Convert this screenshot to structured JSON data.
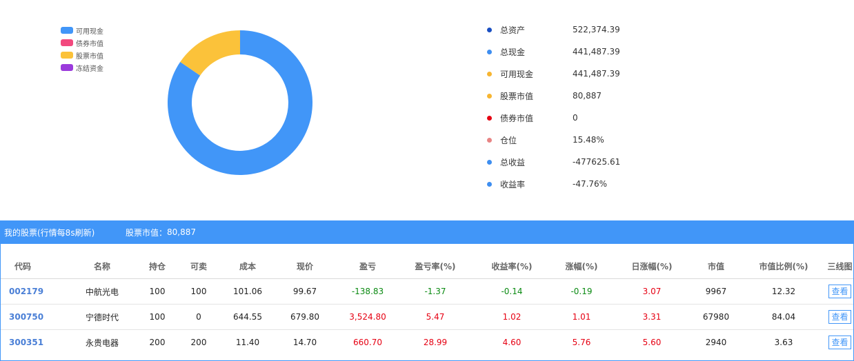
{
  "legend": [
    {
      "label": "可用现金",
      "color": "#4196f8"
    },
    {
      "label": "债券市值",
      "color": "#f2497e"
    },
    {
      "label": "股票市值",
      "color": "#fbc23a"
    },
    {
      "label": "冻结资金",
      "color": "#9b3bdc"
    }
  ],
  "chart_data": {
    "type": "pie",
    "categories": [
      "可用现金",
      "债券市值",
      "股票市值",
      "冻结资金"
    ],
    "values": [
      441487.39,
      0,
      80887,
      0
    ],
    "colors": [
      "#4196f8",
      "#f2497e",
      "#fbc23a",
      "#9b3bdc"
    ]
  },
  "summary": [
    {
      "label": "总资产",
      "value": "522,374.39",
      "color": "#1a4fc2"
    },
    {
      "label": "总现金",
      "value": "441,487.39",
      "color": "#3e8ef0"
    },
    {
      "label": "可用现金",
      "value": "441,487.39",
      "color": "#f7b531"
    },
    {
      "label": "股票市值",
      "value": "80,887",
      "color": "#f7b531"
    },
    {
      "label": "债券市值",
      "value": "0",
      "color": "#e60012"
    },
    {
      "label": "仓位",
      "value": "15.48%",
      "color": "#e88484"
    },
    {
      "label": "总收益",
      "value": "-477625.61",
      "color": "#3e8ef0"
    },
    {
      "label": "收益率",
      "value": "-47.76%",
      "color": "#3e8ef0"
    }
  ],
  "panel": {
    "title": "我的股票(行情每8s刷新)",
    "market_value_label": "股票市值：",
    "market_value": "80,887"
  },
  "table": {
    "headers": [
      "代码",
      "名称",
      "持仓",
      "可卖",
      "成本",
      "现价",
      "盈亏",
      "盈亏率(%)",
      "收益率(%)",
      "涨幅(%)",
      "日涨幅(%)",
      "市值",
      "市值比例(%)",
      "三线图"
    ],
    "view_label": "查看",
    "rows": [
      [
        "002179",
        "中航光电",
        "100",
        "100",
        "101.06",
        "99.67",
        "-138.83",
        "-1.37",
        "-0.14",
        "-0.19",
        "3.07",
        "9967",
        "12.32"
      ],
      [
        "300750",
        "宁德时代",
        "100",
        "0",
        "644.55",
        "679.80",
        "3,524.80",
        "5.47",
        "1.02",
        "1.01",
        "3.31",
        "67980",
        "84.04"
      ],
      [
        "300351",
        "永贵电器",
        "200",
        "200",
        "11.40",
        "14.70",
        "660.70",
        "28.99",
        "4.60",
        "5.76",
        "5.60",
        "2940",
        "3.63"
      ]
    ]
  }
}
